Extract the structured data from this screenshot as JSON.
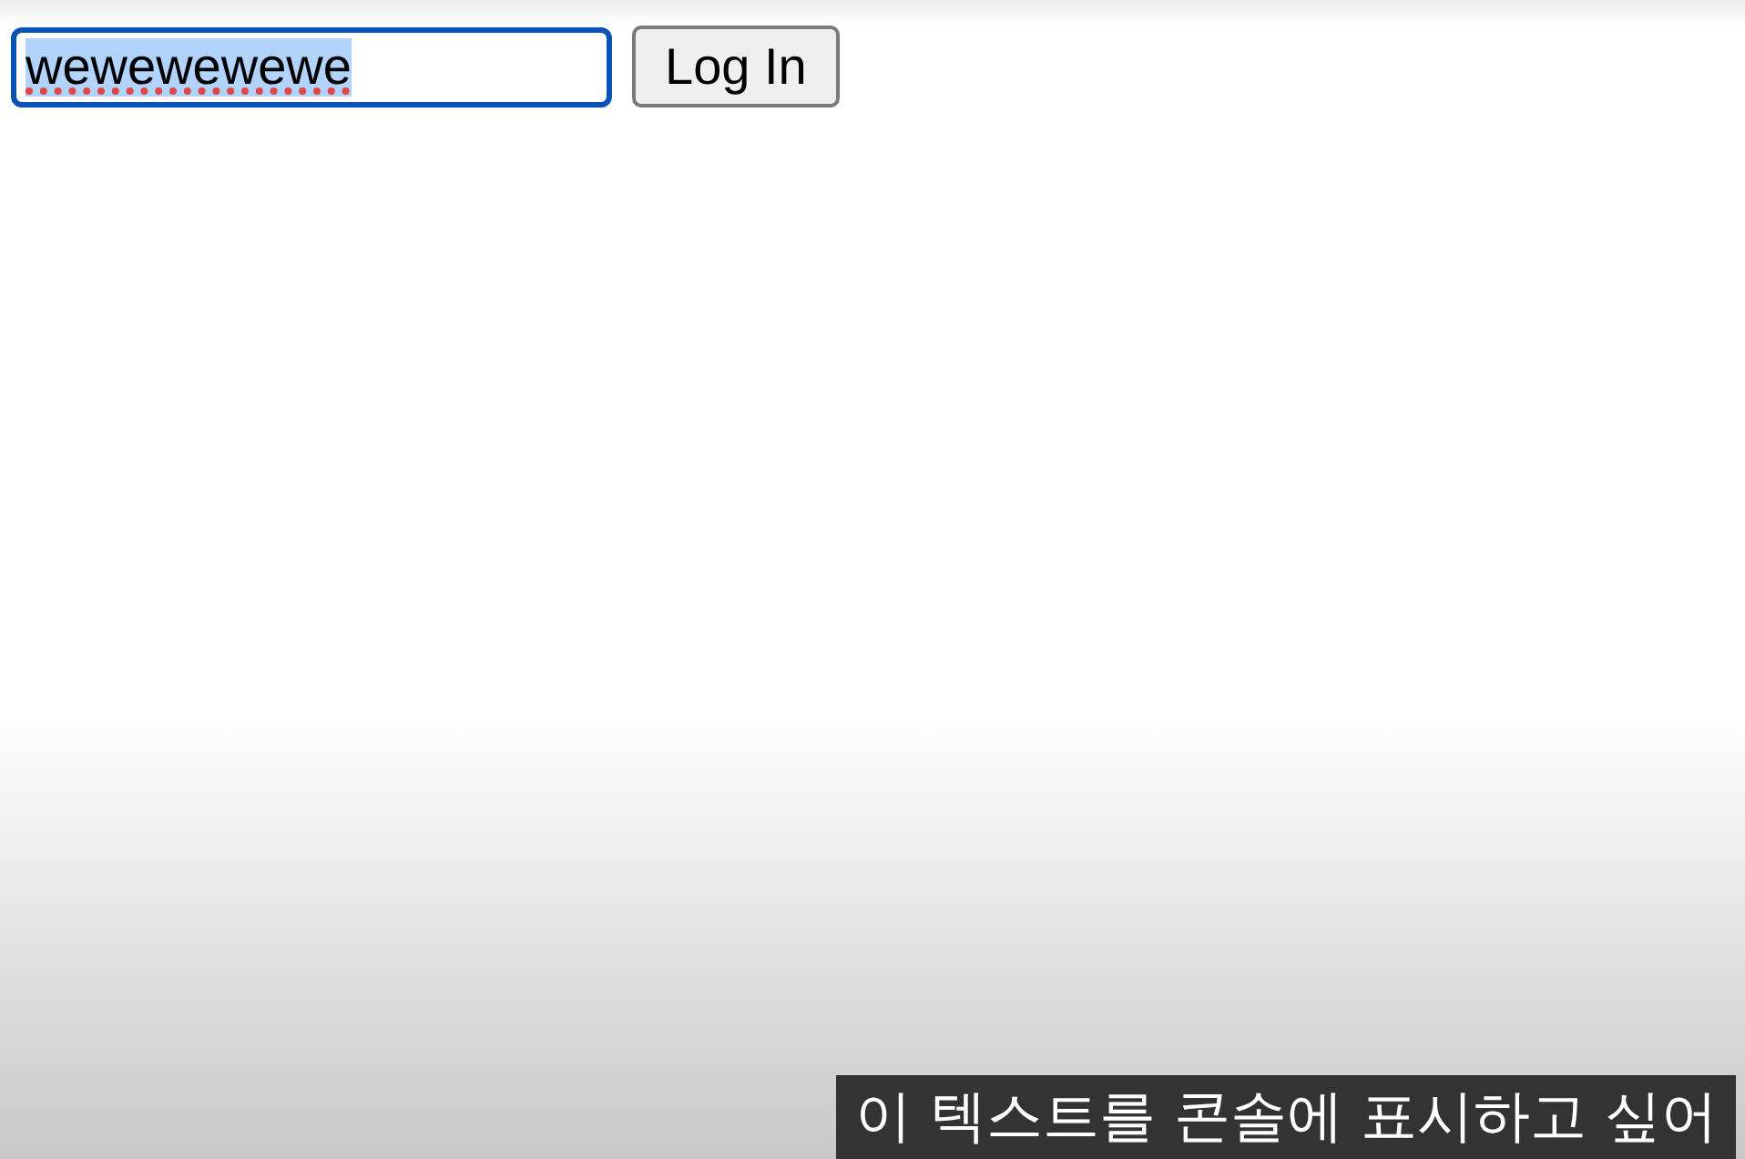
{
  "login_form": {
    "username_field": {
      "value": "wewewewewe",
      "focused": true,
      "text_selected": true,
      "misspelled": true
    },
    "login_button": {
      "label": "Log In"
    }
  },
  "subtitle": {
    "text": "이 텍스트를 콘솔에 표시하고 싶어"
  }
}
